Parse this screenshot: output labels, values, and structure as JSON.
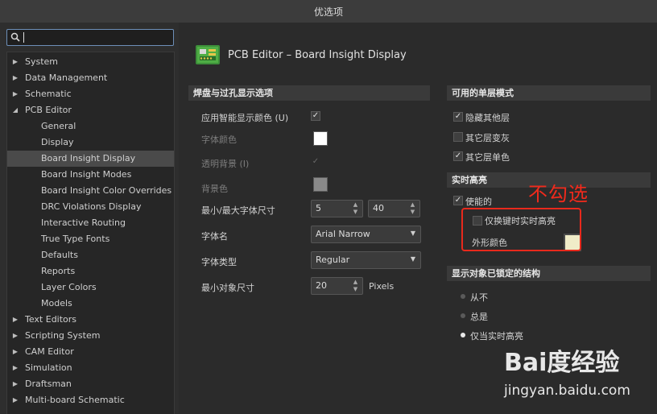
{
  "window": {
    "title": "优选项"
  },
  "search": {
    "value": ""
  },
  "tree": [
    {
      "label": "System",
      "level": 0,
      "expanded": false,
      "selected": false
    },
    {
      "label": "Data Management",
      "level": 0,
      "expanded": false,
      "selected": false
    },
    {
      "label": "Schematic",
      "level": 0,
      "expanded": false,
      "selected": false
    },
    {
      "label": "PCB Editor",
      "level": 0,
      "expanded": true,
      "selected": false
    },
    {
      "label": "General",
      "level": 1,
      "selected": false
    },
    {
      "label": "Display",
      "level": 1,
      "selected": false
    },
    {
      "label": "Board Insight Display",
      "level": 1,
      "selected": true
    },
    {
      "label": "Board Insight Modes",
      "level": 1,
      "selected": false
    },
    {
      "label": "Board Insight Color Overrides",
      "level": 1,
      "selected": false
    },
    {
      "label": "DRC Violations Display",
      "level": 1,
      "selected": false
    },
    {
      "label": "Interactive Routing",
      "level": 1,
      "selected": false
    },
    {
      "label": "True Type Fonts",
      "level": 1,
      "selected": false
    },
    {
      "label": "Defaults",
      "level": 1,
      "selected": false
    },
    {
      "label": "Reports",
      "level": 1,
      "selected": false
    },
    {
      "label": "Layer Colors",
      "level": 1,
      "selected": false
    },
    {
      "label": "Models",
      "level": 1,
      "selected": false
    },
    {
      "label": "Text Editors",
      "level": 0,
      "expanded": false,
      "selected": false
    },
    {
      "label": "Scripting System",
      "level": 0,
      "expanded": false,
      "selected": false
    },
    {
      "label": "CAM Editor",
      "level": 0,
      "expanded": false,
      "selected": false
    },
    {
      "label": "Simulation",
      "level": 0,
      "expanded": false,
      "selected": false
    },
    {
      "label": "Draftsman",
      "level": 0,
      "expanded": false,
      "selected": false
    },
    {
      "label": "Multi-board Schematic",
      "level": 0,
      "expanded": false,
      "selected": false
    }
  ],
  "header": {
    "title": "PCB Editor – Board Insight Display",
    "icon": "pcb-board-icon"
  },
  "pads": {
    "title": "焊盘与过孔显示选项",
    "smart_color_label": "应用智能显示颜色 (U)",
    "smart_color_checked": true,
    "font_color_label": "字体颜色",
    "font_color": "#ffffff",
    "transparent_bg_label": "透明背景 (I)",
    "transparent_bg_checked": true,
    "bg_color_label": "背景色",
    "bg_color": "#8a8a8a",
    "font_size_label": "最小/最大字体尺寸",
    "font_size_min": "5",
    "font_size_max": "40",
    "font_name_label": "字体名",
    "font_name": "Arial Narrow",
    "font_style_label": "字体类型",
    "font_style": "Regular",
    "min_obj_label": "最小对象尺寸",
    "min_obj_value": "20",
    "min_obj_unit": "Pixels"
  },
  "single_layer": {
    "title": "可用的单层模式",
    "hide_others_label": "隐藏其他层",
    "hide_others_checked": true,
    "gray_others_label": "其它层变灰",
    "gray_others_checked": false,
    "mono_others_label": "其它层单色",
    "mono_others_checked": true
  },
  "live_highlight": {
    "title": "实时高亮",
    "enabled_label": "使能的",
    "enabled_checked": true,
    "only_key_label": "仅换键时实时高亮",
    "only_key_checked": false,
    "outline_color_label": "外形颜色",
    "outline_color": "#f0ecc8"
  },
  "locked": {
    "title": "显示对象已锁定的结构",
    "options": [
      "从不",
      "总是",
      "仅当实时高亮"
    ],
    "selected_index": 2
  },
  "annotation": {
    "text": "不勾选",
    "color": "#f02a1c"
  },
  "watermark": {
    "brand": "Bai度经验",
    "site": "jingyan.baidu.com"
  }
}
